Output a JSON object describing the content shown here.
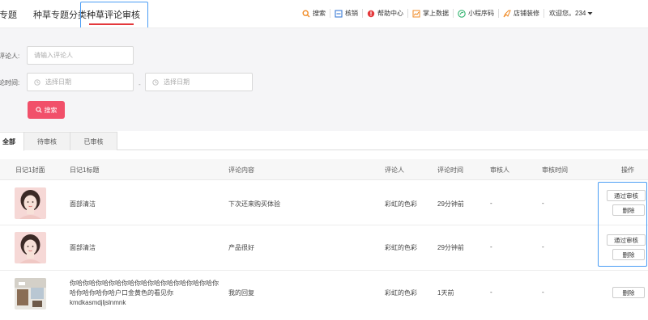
{
  "nav": {
    "tabs": [
      "草专题",
      "种草专题分类",
      "种草评论审核"
    ],
    "tools": [
      "搜索",
      "核销",
      "帮助中心",
      "掌上数据",
      "小程序码",
      "店铺装修"
    ],
    "user": "欢迎您。234"
  },
  "filter": {
    "reviewer_label": "评论人:",
    "reviewer_placeholder": "请输入评论人",
    "time_label": "论时间:",
    "start_placeholder": "选择日期",
    "separator": "-",
    "end_placeholder": "选择日期",
    "search_label": "搜索"
  },
  "subtabs": [
    "全部",
    "待审核",
    "已审核"
  ],
  "table": {
    "headers": [
      "日记1封面",
      "日记1标题",
      "评论内容",
      "评论人",
      "评论时间",
      "审核人",
      "审核时间",
      "操作"
    ],
    "rows": [
      {
        "title": "面部清洁",
        "comment": "下次还来购买体验",
        "reviewer": "彩虹的色彩",
        "time": "29分钟前",
        "auditor": "-",
        "audit_time": "-",
        "approve": "通过审核",
        "delete": "删除"
      },
      {
        "title": "面部清洁",
        "comment": "产品很好",
        "reviewer": "彩虹的色彩",
        "time": "29分钟前",
        "auditor": "-",
        "audit_time": "-",
        "approve": "通过审核",
        "delete": "删除"
      },
      {
        "title": "你哈你哈你哈你哈你哈你哈你哈你哈你哈你哈你哈你哈你哈你哈你哈户口金黄色的看见你kmdkasmdjljslnmnk",
        "comment": "我的回复",
        "reviewer": "彩虹的色彩",
        "time": "1天前",
        "auditor": "-",
        "audit_time": "-",
        "delete": "删除"
      }
    ]
  },
  "colors": {
    "accent": "#f1506a",
    "highlight": "#4a9df5",
    "active_tab_line": "#e4393c"
  }
}
